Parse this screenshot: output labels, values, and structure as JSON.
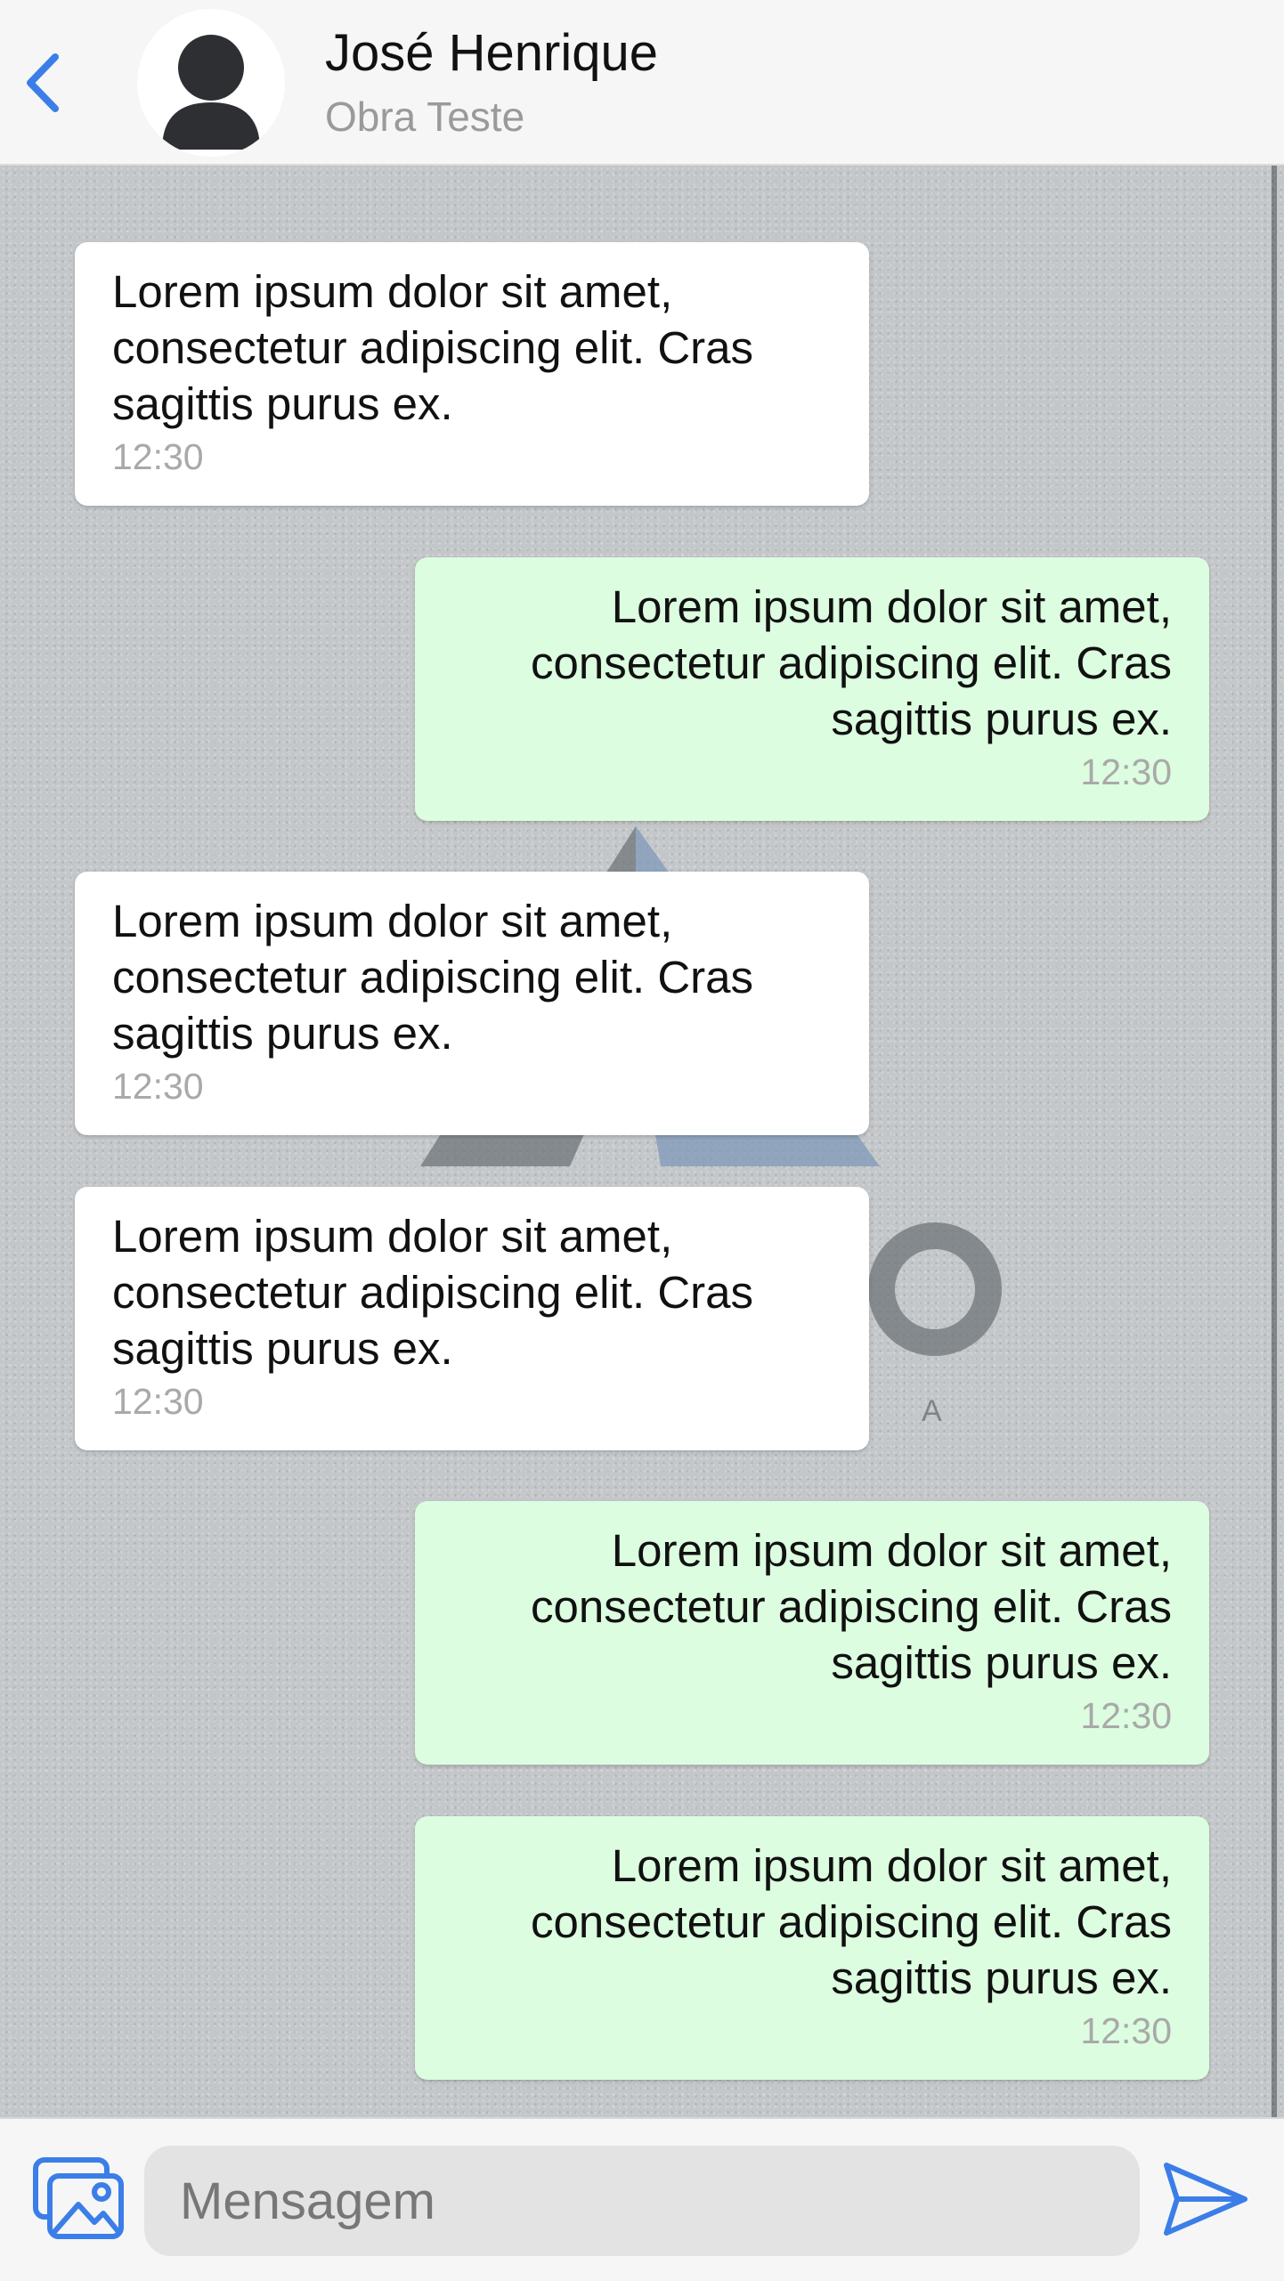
{
  "header": {
    "contact_name": "José Henrique",
    "contact_subtitle": "Obra Teste",
    "back_icon": "chevron-left-icon",
    "avatar_icon": "person-icon"
  },
  "chat": {
    "messages": [
      {
        "direction": "incoming",
        "text": "Lorem ipsum dolor sit amet, consectetur adipiscing elit. Cras sagittis purus ex.",
        "time": "12:30"
      },
      {
        "direction": "outgoing",
        "text": "Lorem ipsum dolor sit amet, consectetur adipiscing elit. Cras sagittis purus ex.",
        "time": "12:30"
      },
      {
        "direction": "incoming",
        "text": "Lorem ipsum dolor sit amet, consectetur adipiscing elit. Cras sagittis purus ex.",
        "time": "12:30"
      },
      {
        "direction": "incoming",
        "text": "Lorem ipsum dolor sit amet, consectetur adipiscing elit. Cras sagittis purus ex.",
        "time": "12:30"
      },
      {
        "direction": "outgoing",
        "text": "Lorem ipsum dolor sit amet, consectetur adipiscing elit. Cras sagittis purus ex.",
        "time": "12:30"
      },
      {
        "direction": "outgoing",
        "text": "Lorem ipsum dolor sit amet, consectetur adipiscing elit. Cras sagittis purus ex.",
        "time": "12:30"
      }
    ]
  },
  "composer": {
    "placeholder": "Mensagem",
    "value": "",
    "image_icon": "image-icon",
    "send_icon": "send-icon"
  },
  "colors": {
    "accent": "#3b7ee8",
    "incoming_bubble": "#ffffff",
    "outgoing_bubble": "#dcfde0",
    "time_text": "#a9a9a9",
    "header_background": "#f6f6f6"
  }
}
